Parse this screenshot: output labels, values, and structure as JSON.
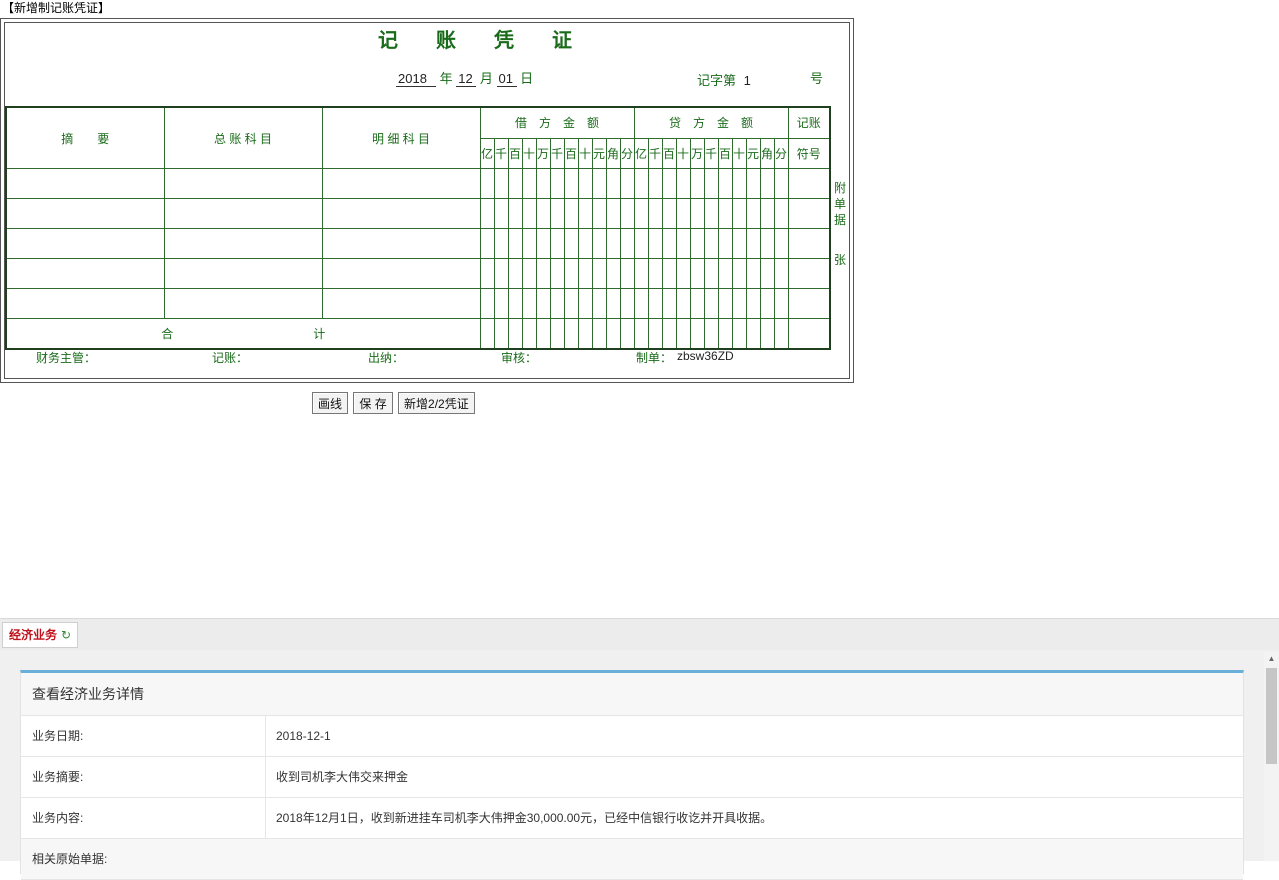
{
  "page_title": "【新增制记账凭证】",
  "voucher": {
    "title_chars": [
      "记",
      "账",
      "凭",
      "证"
    ],
    "date": {
      "year": "2018",
      "year_label": "年",
      "month": "12",
      "month_label": "月",
      "day": "01",
      "day_label": "日"
    },
    "number": {
      "prefix": "记字第",
      "value": "1",
      "suffix": "号"
    },
    "headers": {
      "summary": "摘　　要",
      "ledger": "总 账 科 目",
      "detail": "明 细 科 目",
      "debit": "借　方　金　额",
      "credit": "贷　方　金　额",
      "mark_top": "记账",
      "mark_bottom": "符号"
    },
    "digits": [
      "亿",
      "千",
      "百",
      "十",
      "万",
      "千",
      "百",
      "十",
      "元",
      "角",
      "分"
    ],
    "total_left": "合",
    "total_right": "计",
    "attach": [
      "附",
      "单",
      "据",
      "张"
    ],
    "signatures": {
      "finance": "财务主管：",
      "bookkeeper": "记账：",
      "cashier": "出纳：",
      "audit": "审核：",
      "maker": "制单：",
      "maker_value": "zbsw36ZD"
    }
  },
  "buttons": {
    "draw_line": "画线",
    "save": "保 存",
    "add": "新增2/2凭证"
  },
  "tab": {
    "label": "经济业务",
    "refresh_icon": "refresh-icon"
  },
  "detail": {
    "heading": "查看经济业务详情",
    "rows": [
      {
        "key": "业务日期:",
        "value": "2018-12-1"
      },
      {
        "key": "业务摘要:",
        "value": "收到司机李大伟交来押金"
      },
      {
        "key": "业务内容:",
        "value": "2018年12月1日，收到新进挂车司机李大伟押金30,000.00元，已经中信银行收讫并开具收据。"
      },
      {
        "key": "相关原始单据:",
        "value": ""
      }
    ]
  },
  "colors": {
    "voucher_green": "#1a6b1a",
    "tab_red": "#c0121a",
    "card_accent": "#6ab0d8"
  }
}
